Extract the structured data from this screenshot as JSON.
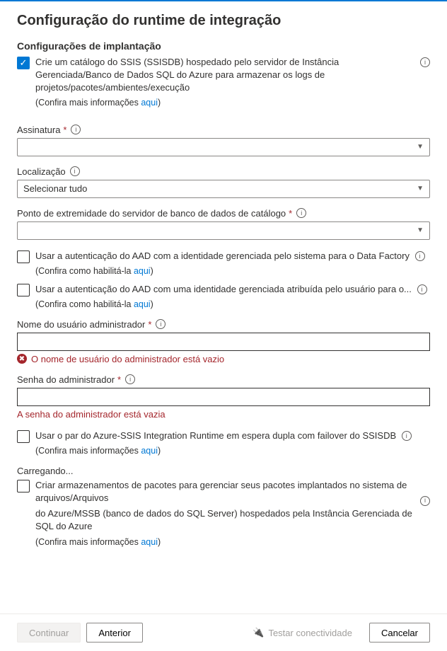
{
  "title": "Configuração do runtime de integração",
  "deploy": {
    "section_title": "Configurações de implantação",
    "create_catalog": "Crie um catálogo do SSIS (SSISDB) hospedado pelo servidor de Instância Gerenciada/Banco de Dados SQL do Azure para armazenar os logs de projetos/pacotes/ambientes/execução",
    "more_info_prefix": "(Confira mais informações ",
    "here": "aqui",
    "close_paren": ")"
  },
  "subscription": {
    "label": "Assinatura",
    "value": ""
  },
  "location": {
    "label": "Localização",
    "value": "Selecionar tudo"
  },
  "endpoint": {
    "label": "Ponto de extremidade do servidor de banco de dados de catálogo",
    "value": ""
  },
  "aad_system": {
    "label": "Usar a autenticação do AAD com a identidade gerenciada pelo sistema para o Data Factory",
    "help_prefix": "(Confira como habilitá-la ",
    "here": "aqui",
    "close_paren": ")"
  },
  "aad_user": {
    "label": "Usar a autenticação do AAD com uma identidade gerenciada atribuída pelo usuário para o...",
    "help_prefix": "(Confira como habilitá-la ",
    "here": "aqui",
    "close_paren": ")"
  },
  "admin_user": {
    "label": "Nome do usuário administrador",
    "value": "",
    "error": "O nome de usuário do administrador está vazio"
  },
  "admin_pass": {
    "label": "Senha do administrador",
    "value": "",
    "error": "A senha do administrador está vazia"
  },
  "standby": {
    "label": "Usar o par do Azure-SSIS Integration Runtime em espera dupla com failover do SSISDB",
    "help_prefix": "(Confira mais informações ",
    "here": "aqui",
    "close_paren": ")"
  },
  "package_store": {
    "loading": "Carregando...",
    "line1": "Criar armazenamentos de pacotes para gerenciar seus pacotes implantados no sistema de arquivos/Arquivos",
    "line2": "do Azure/MSSB (banco de dados do SQL Server) hospedados pela Instância Gerenciada de SQL do Azure",
    "help_prefix": "(Confira mais informações ",
    "here": "aqui",
    "close_paren": ")"
  },
  "footer": {
    "continue": "Continuar",
    "previous": "Anterior",
    "test": "Testar conectividade",
    "cancel": "Cancelar"
  }
}
